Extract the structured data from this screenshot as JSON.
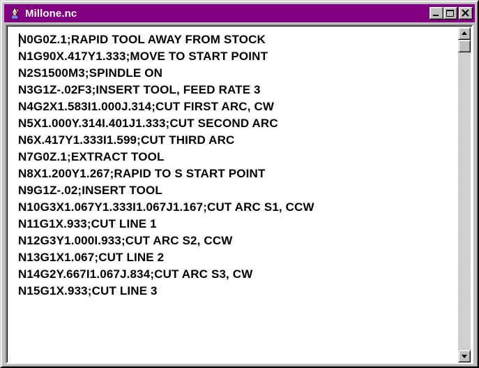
{
  "window": {
    "title": "Millone.nc",
    "icon": "wizard-app-icon",
    "controls": {
      "minimize": "minimize-icon",
      "maximize": "maximize-icon",
      "close": "close-icon"
    }
  },
  "editor": {
    "lines": [
      "N0G0Z.1;RAPID TOOL AWAY FROM STOCK",
      "N1G90X.417Y1.333;MOVE TO START POINT",
      "N2S1500M3;SPINDLE ON",
      "N3G1Z-.02F3;INSERT TOOL, FEED RATE 3",
      "N4G2X1.583I1.000J.314;CUT FIRST ARC, CW",
      "N5X1.000Y.314I.401J1.333;CUT SECOND ARC",
      "N6X.417Y1.333I1.599;CUT THIRD ARC",
      "N7G0Z.1;EXTRACT TOOL",
      "N8X1.200Y1.267;RAPID TO S START POINT",
      "N9G1Z-.02;INSERT TOOL",
      "N10G3X1.067Y1.333I1.067J1.167;CUT ARC S1, CCW",
      "N11G1X.933;CUT LINE 1",
      "N12G3Y1.000I.933;CUT ARC S2, CCW",
      "N13G1X1.067;CUT LINE 2",
      "N14G2Y.667I1.067J.834;CUT ARC S3, CW",
      "N15G1X.933;CUT LINE 3"
    ]
  },
  "scrollbar": {
    "up": "scroll-up-arrow-icon",
    "down": "scroll-down-arrow-icon"
  },
  "colors": {
    "titlebar": "#800080",
    "title_text": "#ffffff",
    "chrome": "#c0c0c0",
    "text_area": "#ffffff"
  }
}
